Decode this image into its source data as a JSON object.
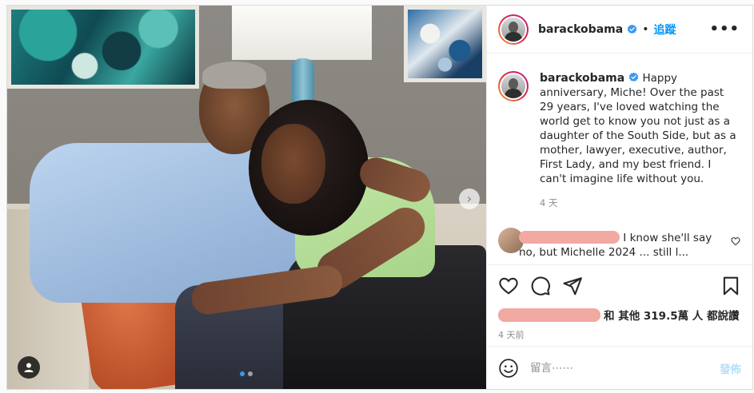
{
  "author": {
    "username": "barackobama",
    "follow_label": "追蹤",
    "separator": "•",
    "more_label": "•••"
  },
  "caption": {
    "username": "barackobama",
    "text": "Happy anniversary, Miche! Over the past 29 years, I've loved watching the world get to know you not just as a daughter of the South Side, but as a mother, lawyer, executive, author, First Lady, and my best friend. I can't imagine life without you.",
    "time": "4 天"
  },
  "comment": {
    "text": "I know she'll say no, but Michelle 2024 ... still l..."
  },
  "likes": {
    "text": "和 其他 319.5萬 人 都說讚"
  },
  "post_time": "4 天前",
  "composer": {
    "placeholder": "留言⋯⋯",
    "post_label": "發佈"
  },
  "media": {
    "next_label": "›",
    "slide_index": 1,
    "slide_count": 2
  },
  "colors": {
    "accent": "#0095f6",
    "post_disabled": "#b2dffc",
    "verified": "#3897f0",
    "redaction": "#f2a9a1"
  }
}
